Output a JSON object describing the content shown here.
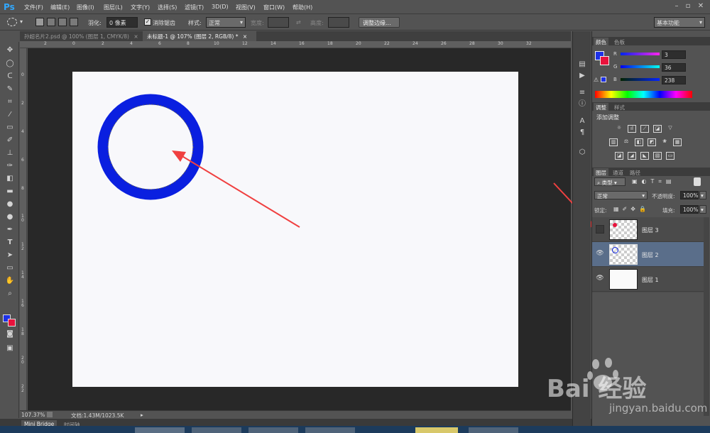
{
  "app": {
    "logo": "Ps"
  },
  "menu": [
    "文件(F)",
    "编辑(E)",
    "图像(I)",
    "图层(L)",
    "文字(Y)",
    "选择(S)",
    "滤镜(T)",
    "3D(D)",
    "视图(V)",
    "窗口(W)",
    "帮助(H)"
  ],
  "options": {
    "feather_label": "羽化:",
    "feather_value": "0 像素",
    "antialias_label": "消除锯齿",
    "style_label": "样式:",
    "style_value": "正常",
    "width_label": "宽度:",
    "height_label": "高度:",
    "refine_button": "调整边缘...",
    "workspace": "基本功能"
  },
  "tabs": [
    {
      "label": "孙超名片2.psd @ 100% (图层 1, CMYK/8)",
      "close": "×"
    },
    {
      "label": "未标题-1 @ 107% (图层 2, RGB/8) *",
      "close": "×"
    }
  ],
  "ruler_top": [
    "2",
    "0",
    "2",
    "4",
    "6",
    "8",
    "10",
    "12",
    "14",
    "16",
    "18",
    "20",
    "22",
    "24",
    "26",
    "28",
    "30",
    "32"
  ],
  "ruler_left": [
    "0",
    "2",
    "4",
    "6",
    "8",
    "1\n0",
    "1\n2",
    "1\n4",
    "1\n6",
    "1\n8",
    "2\n0",
    "2\n2"
  ],
  "status": {
    "zoom": "107.37%",
    "doc": "文档:1.43M/1023.5K"
  },
  "bottom_tabs": [
    "Mini Bridge",
    "时间轴"
  ],
  "color_panel": {
    "tabs": [
      "颜色",
      "色板"
    ],
    "fg": "#1e31e6",
    "bg": "#e8123c",
    "r_label": "R",
    "g_label": "G",
    "b_label": "B",
    "r": "3",
    "g": "36",
    "b": "238"
  },
  "adjust_panel": {
    "tabs": [
      "调整",
      "样式"
    ],
    "title": "添加调整"
  },
  "layers_panel": {
    "tabs": [
      "图层",
      "通道",
      "路径"
    ],
    "filter": "类型",
    "blend": "正常",
    "opacity_label": "不透明度:",
    "opacity": "100%",
    "lock_label": "锁定:",
    "fill_label": "填充:",
    "fill": "100%",
    "layers": [
      {
        "name": "图层 3",
        "visible": false,
        "selected": false
      },
      {
        "name": "图层 2",
        "visible": true,
        "selected": true
      },
      {
        "name": "图层 1",
        "visible": true,
        "selected": false
      }
    ]
  },
  "canvas": {
    "circle_color": "#0a1fe0"
  },
  "watermark": {
    "brand": "Bai 经验",
    "url": "jingyan.baidu.com"
  }
}
